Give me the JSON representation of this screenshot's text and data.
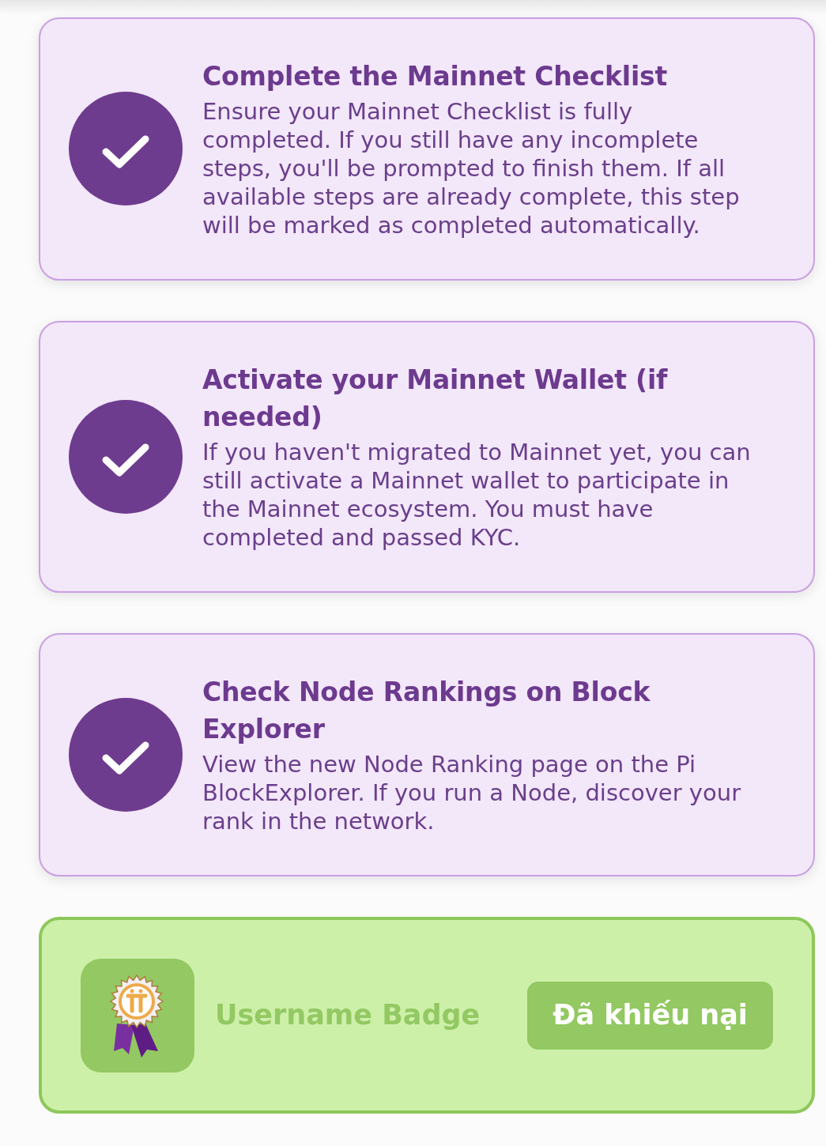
{
  "tasks": [
    {
      "title": "Complete the Mainnet Checklist",
      "description": "Ensure your Mainnet Checklist is fully completed. If you still have any incomplete steps, you'll be prompted to finish them. If all available steps are already complete, this step will be marked as completed automatically.",
      "completed": true
    },
    {
      "title": "Activate your Mainnet Wallet (if needed)",
      "description": "If you haven't migrated to Mainnet yet, you can still activate a Mainnet wallet to participate in the Mainnet ecosystem. You must have completed and passed KYC.",
      "completed": true
    },
    {
      "title": "Check Node Rankings on Block Explorer",
      "description": "View the new Node Ranking page on the Pi BlockExplorer. If you run a Node, discover your rank in the network.",
      "completed": true
    }
  ],
  "badge": {
    "name": "Username Badge",
    "button": "Đã khiếu nại",
    "claimed": true
  }
}
